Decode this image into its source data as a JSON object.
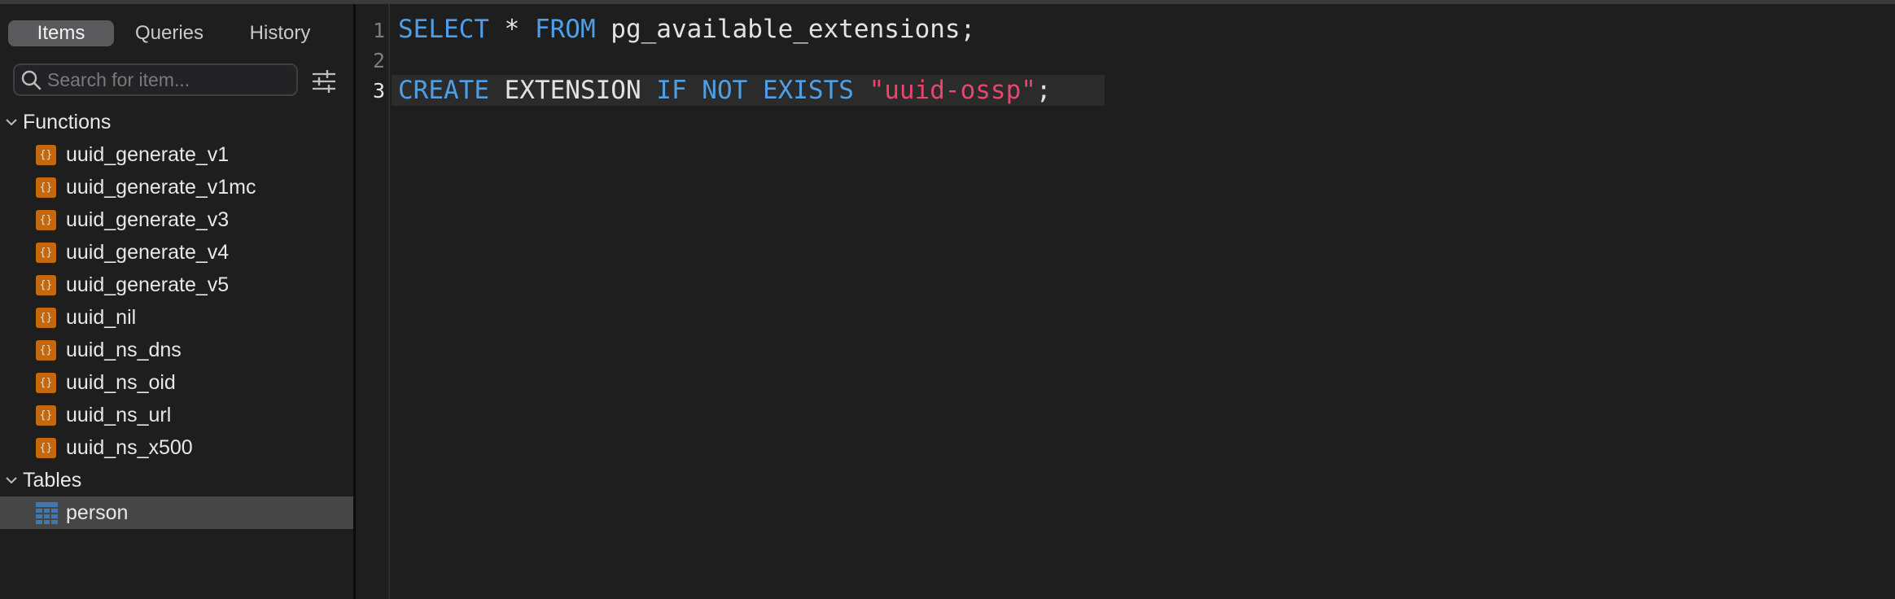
{
  "sidebar": {
    "tabs": [
      {
        "label": "Items",
        "active": true
      },
      {
        "label": "Queries",
        "active": false
      },
      {
        "label": "History",
        "active": false
      }
    ],
    "search": {
      "placeholder": "Search for item...",
      "value": ""
    },
    "groups": [
      {
        "label": "Functions",
        "expanded": true,
        "icon": "function-icon",
        "items": [
          "uuid_generate_v1",
          "uuid_generate_v1mc",
          "uuid_generate_v3",
          "uuid_generate_v4",
          "uuid_generate_v5",
          "uuid_nil",
          "uuid_ns_dns",
          "uuid_ns_oid",
          "uuid_ns_url",
          "uuid_ns_x500"
        ]
      },
      {
        "label": "Tables",
        "expanded": true,
        "icon": "table-icon",
        "items": [
          "person"
        ],
        "selected_item": "person"
      }
    ]
  },
  "editor": {
    "active_line": 3,
    "lines": [
      {
        "number": "1",
        "tokens": [
          {
            "text": "SELECT",
            "type": "keyword"
          },
          {
            "text": " * ",
            "type": "plain"
          },
          {
            "text": "FROM",
            "type": "keyword"
          },
          {
            "text": " pg_available_extensions;",
            "type": "plain"
          }
        ]
      },
      {
        "number": "2",
        "tokens": []
      },
      {
        "number": "3",
        "tokens": [
          {
            "text": "CREATE",
            "type": "keyword"
          },
          {
            "text": " EXTENSION ",
            "type": "plain"
          },
          {
            "text": "IF NOT EXISTS",
            "type": "keyword"
          },
          {
            "text": " ",
            "type": "plain"
          },
          {
            "text": "\"uuid-ossp\"",
            "type": "string"
          },
          {
            "text": ";",
            "type": "plain"
          }
        ]
      }
    ]
  },
  "colors": {
    "keyword": "#4f9fe6",
    "string": "#e8466f",
    "function_icon": "#c7670d",
    "table_icon": "#3f78b0",
    "selected_row": "#464646"
  }
}
